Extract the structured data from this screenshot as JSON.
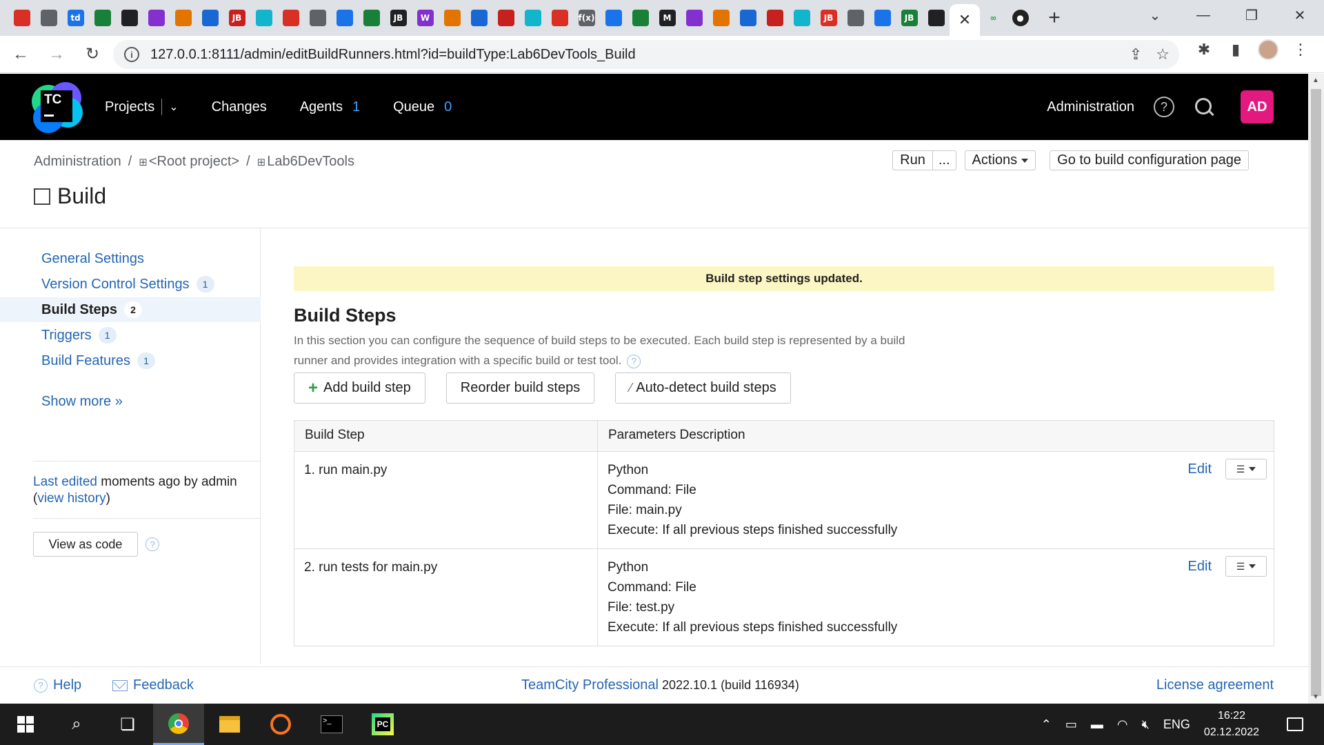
{
  "browser": {
    "url": "127.0.0.1:8111/admin/editBuildRunners.html?id=buildType:Lab6DevTools_Build",
    "tab_icons": [
      "gmail-icon",
      "charp-icon",
      "td-icon",
      "gmail-icon",
      "drive-icon",
      "bot-icon",
      "github-icon",
      "page-icon",
      "jb-icon",
      "triangle-icon",
      "cube-icon",
      "shield-icon",
      "ms-icon",
      "infinity-icon",
      "jb-icon",
      "wiki-icon",
      "bot-icon",
      "leaf-icon",
      "drive-icon",
      "beats-icon",
      "globe-icon",
      "fx-icon",
      "x-icon",
      "wordpress-icon",
      "m-icon",
      "bot-icon",
      "github-icon",
      "globe-icon",
      "trophy-icon",
      "code-icon",
      "jb-icon",
      "wave-icon",
      "shield-icon",
      "jb-icon",
      "snowflake-icon"
    ],
    "tab_letters": {
      "td-icon": "td",
      "jb-icon": "JB",
      "wiki-icon": "W",
      "fx-icon": "f(x)",
      "m-icon": "M"
    }
  },
  "header": {
    "logo_text": "TC",
    "nav": {
      "projects": "Projects",
      "changes": "Changes",
      "agents": "Agents",
      "agents_count": "1",
      "queue": "Queue",
      "queue_count": "0"
    },
    "administration": "Administration",
    "avatar": "AD"
  },
  "breadcrumb": {
    "administration": "Administration",
    "root": "<Root project>",
    "project": "Lab6DevTools"
  },
  "page_title": "Build",
  "top_actions": {
    "run": "Run",
    "run_more": "...",
    "actions": "Actions",
    "go_to": "Go to build configuration page"
  },
  "sidebar": {
    "items": [
      {
        "label": "General Settings",
        "badge": ""
      },
      {
        "label": "Version Control Settings",
        "badge": "1"
      },
      {
        "label": "Build Steps",
        "badge": "2"
      },
      {
        "label": "Triggers",
        "badge": "1"
      },
      {
        "label": "Build Features",
        "badge": "1"
      }
    ],
    "show_more": "Show more »",
    "last_edited_link": "Last edited",
    "last_edited_text": "moments ago by admin",
    "view_history": "view history",
    "view_as_code": "View as code"
  },
  "main": {
    "notice": "Build step settings updated.",
    "title": "Build Steps",
    "description": "In this section you can configure the sequence of build steps to be executed. Each build step is represented by a build runner and provides integration with a specific build or test tool.",
    "buttons": {
      "add": "Add build step",
      "reorder": "Reorder build steps",
      "autodetect": "Auto-detect build steps"
    },
    "table": {
      "headers": [
        "Build Step",
        "Parameters Description"
      ],
      "edit_label": "Edit",
      "rows": [
        {
          "name": "1. run main.py",
          "params": [
            "Python",
            "Command: File",
            "File: main.py",
            "Execute: If all previous steps finished successfully"
          ]
        },
        {
          "name": "2. run tests for main.py",
          "params": [
            "Python",
            "Command: File",
            "File: test.py",
            "Execute: If all previous steps finished successfully"
          ]
        }
      ]
    }
  },
  "footer": {
    "help": "Help",
    "feedback": "Feedback",
    "product_link": "TeamCity Professional",
    "version": "2022.10.1 (build 116934)",
    "license": "License agreement"
  },
  "taskbar": {
    "lang": "ENG",
    "time": "16:22",
    "date": "02.12.2022"
  },
  "colors": {
    "link": "#2465b3",
    "header_bg": "#000000",
    "avatar": "#e3197f",
    "notice_bg": "#fbf6c4",
    "count": "#3ea1ff"
  }
}
